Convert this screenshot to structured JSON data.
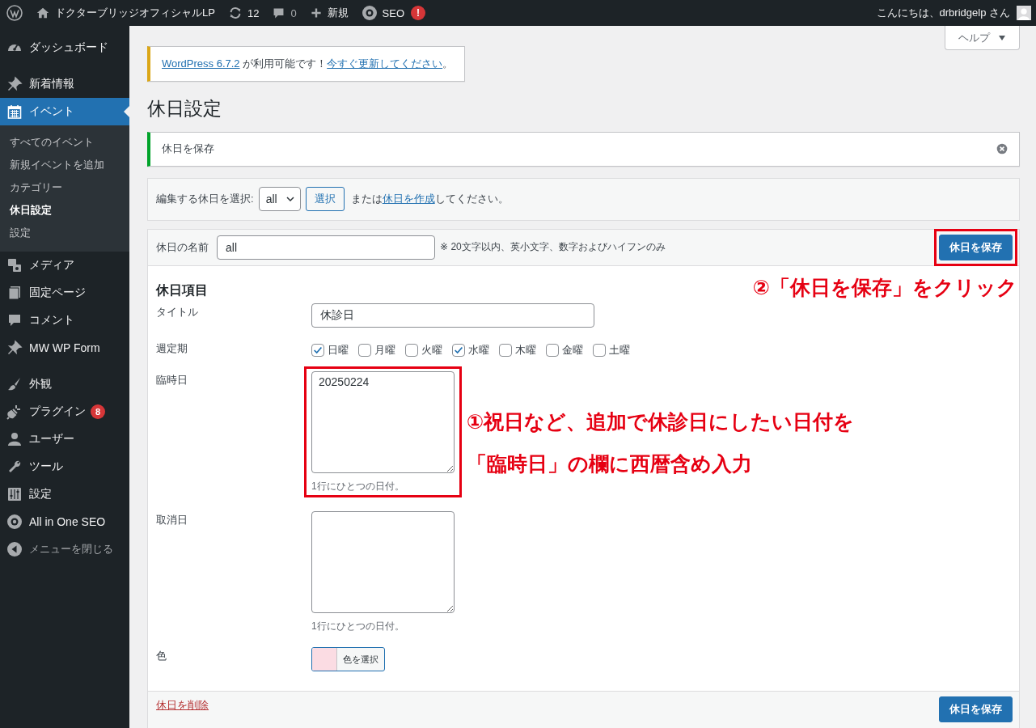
{
  "admin_bar": {
    "site_name": "ドクターブリッジオフィシャルLP",
    "updates": "12",
    "comments": "0",
    "new": "新規",
    "seo": "SEO",
    "seo_badge": "!",
    "greeting": "こんにちは、drbridgelp さん"
  },
  "sidebar": {
    "groups": [
      {
        "items": [
          {
            "label": "ダッシュボード",
            "selected": false
          }
        ]
      },
      {
        "items": [
          {
            "label": "新着情報",
            "selected": false
          },
          {
            "label": "イベント",
            "selected": true,
            "children": [
              {
                "label": "すべてのイベント",
                "selected": false
              },
              {
                "label": "新規イベントを追加",
                "selected": false
              },
              {
                "label": "カテゴリー",
                "selected": false
              },
              {
                "label": "休日設定",
                "selected": true
              },
              {
                "label": "設定",
                "selected": false
              }
            ]
          },
          {
            "label": "メディア",
            "selected": false
          },
          {
            "label": "固定ページ",
            "selected": false
          },
          {
            "label": "コメント",
            "selected": false
          },
          {
            "label": "MW WP Form",
            "selected": false
          }
        ]
      },
      {
        "items": [
          {
            "label": "外観",
            "selected": false
          },
          {
            "label": "プラグイン",
            "selected": false,
            "badge": "8"
          },
          {
            "label": "ユーザー",
            "selected": false
          },
          {
            "label": "ツール",
            "selected": false
          },
          {
            "label": "設定",
            "selected": false
          },
          {
            "label": "All in One SEO",
            "selected": false
          }
        ]
      }
    ],
    "collapse_label": "メニューを閉じる"
  },
  "help_button": "ヘルプ",
  "update_notice": {
    "parts": [
      {
        "text": "WordPress 6.7.2",
        "link": true
      },
      {
        "text": " が利用可能です！",
        "link": false
      },
      {
        "text": "今すぐ更新してください",
        "link": true
      },
      {
        "text": "。",
        "link": false
      }
    ]
  },
  "page_title": "休日設定",
  "success_notice": {
    "message": "休日を保存"
  },
  "selector": {
    "label": "編集する休日を選択:",
    "value": "all",
    "button": "選択",
    "parts": [
      {
        "text": "または",
        "link": false
      },
      {
        "text": "休日を作成",
        "link": true
      },
      {
        "text": "してください。",
        "link": false
      }
    ]
  },
  "form": {
    "name_label": "休日の名前",
    "name_value": "all",
    "name_note": "※ 20文字以内、英小文字、数字およびハイフンのみ",
    "save_button": {
      "label": "休日を保存",
      "highlighted": true
    },
    "save_annotation": "②「休日を保存」をクリック",
    "section_title": "休日項目",
    "fields": [
      {
        "kind": "text",
        "label": "タイトル",
        "value": "休診日",
        "highlighted": false
      },
      {
        "kind": "checkboxes",
        "label": "週定期",
        "highlighted": false,
        "options": [
          {
            "label": "日曜",
            "checked": true
          },
          {
            "label": "月曜",
            "checked": false
          },
          {
            "label": "火曜",
            "checked": false
          },
          {
            "label": "水曜",
            "checked": true
          },
          {
            "label": "木曜",
            "checked": false
          },
          {
            "label": "金曜",
            "checked": false
          },
          {
            "label": "土曜",
            "checked": false
          }
        ]
      },
      {
        "kind": "textarea",
        "label": "臨時日",
        "value": "20250224",
        "hint": "1行にひとつの日付。",
        "highlighted": true,
        "annotation_lines": [
          "①祝日など、追加で休診日にしたい日付を",
          "「臨時日」の欄に西暦含め入力"
        ]
      },
      {
        "kind": "textarea",
        "label": "取消日",
        "hint": "1行にひとつの日付。",
        "highlighted": false
      },
      {
        "kind": "color",
        "label": "色",
        "color": "#fbdce3",
        "button": "色を選択",
        "highlighted": false
      }
    ],
    "delete_link": "休日を削除",
    "footer_save_button": "休日を保存"
  }
}
